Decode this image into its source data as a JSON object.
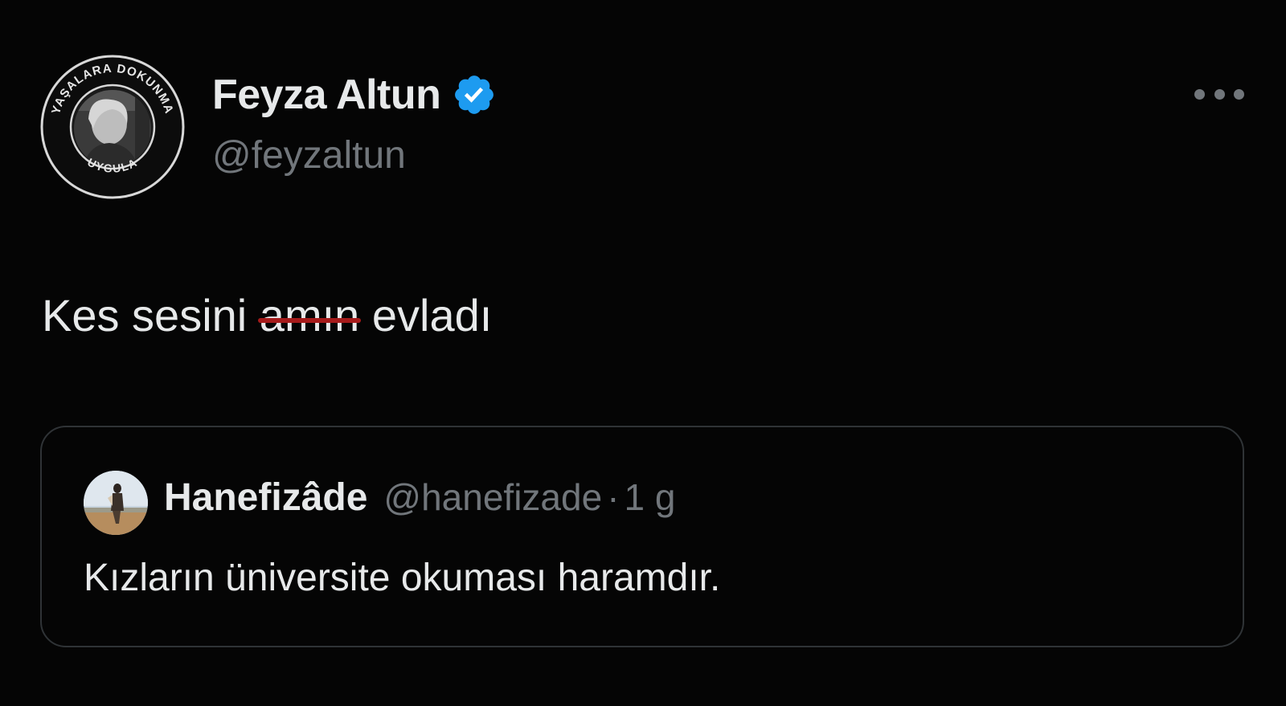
{
  "author": {
    "name": "Feyza Altun",
    "handle": "@feyzaltun",
    "verified": true,
    "avatar_badge_top_text": "YAŞALARA DOKUNMA",
    "avatar_badge_bottom_text": "UYGULA"
  },
  "tweet": {
    "text_before": "Kes sesini ",
    "text_censored": "amın",
    "text_after": " evladı"
  },
  "quoted": {
    "name": "Hanefizâde",
    "handle": "@hanefizade",
    "separator": "·",
    "time": "1 g",
    "text": "Kızların üniversite okuması haramdır."
  },
  "colors": {
    "background": "#050505",
    "text": "#e7e9ea",
    "secondary": "#71767b",
    "verified": "#1d9bf0",
    "strike": "#a61b1b",
    "border": "#2f3336"
  },
  "icons": {
    "verified": "verified-badge-icon",
    "more": "more-horizontal-icon"
  }
}
